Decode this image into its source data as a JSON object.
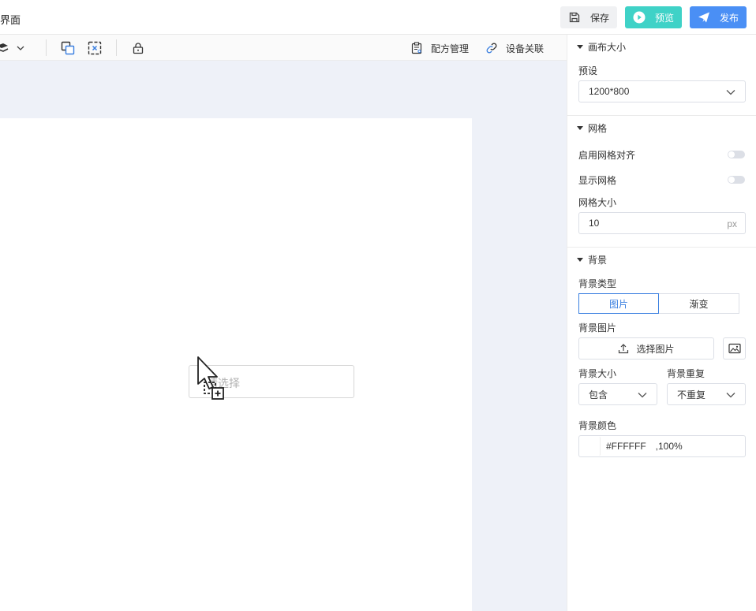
{
  "header": {
    "title": "界面",
    "save_label": "保存",
    "preview_label": "预览",
    "publish_label": "发布"
  },
  "toolbar": {
    "recipe_label": "配方管理",
    "device_label": "设备关联"
  },
  "canvas": {
    "select_placeholder": "请选择"
  },
  "panel": {
    "canvas_size": {
      "section_title": "画布大小",
      "preset_label": "预设",
      "preset_value": "1200*800"
    },
    "grid": {
      "section_title": "网格",
      "snap_label": "启用网格对齐",
      "snap_enabled": false,
      "show_label": "显示网格",
      "show_enabled": false,
      "size_label": "网格大小",
      "size_value": "10",
      "size_unit": "px"
    },
    "background": {
      "section_title": "背景",
      "type_label": "背景类型",
      "type_options": [
        "图片",
        "渐变"
      ],
      "type_selected": "图片",
      "image_label": "背景图片",
      "choose_image_label": "选择图片",
      "size_label": "背景大小",
      "size_value": "包含",
      "repeat_label": "背景重复",
      "repeat_value": "不重复",
      "color_label": "背景颜色",
      "color_value": "#FFFFFF",
      "opacity_value": ",100%"
    }
  },
  "colors": {
    "preview_btn": "#3fd2c7",
    "publish_btn": "#4a8ff5",
    "accent": "#3a7fe0",
    "canvas_bg": "#eef1f8"
  }
}
